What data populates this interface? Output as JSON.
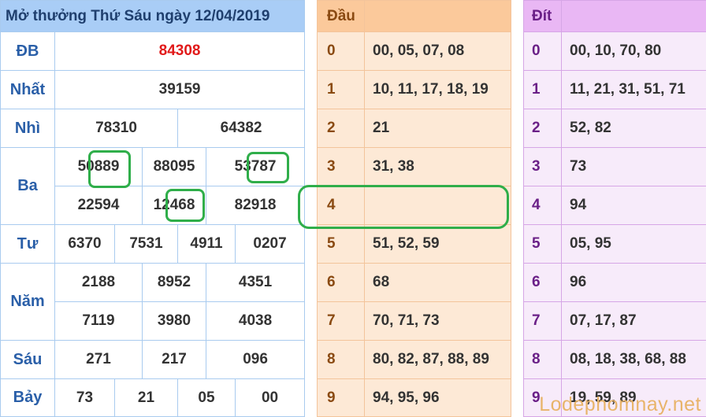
{
  "results": {
    "title": "Mở thưởng Thứ Sáu ngày 12/04/2019",
    "db_label": "ĐB",
    "db": "84308",
    "nhat_label": "Nhất",
    "nhat": "39159",
    "nhi_label": "Nhì",
    "nhi": [
      "78310",
      "64382"
    ],
    "ba_label": "Ba",
    "ba": [
      "50889",
      "88095",
      "53787",
      "22594",
      "12468",
      "82918"
    ],
    "tu_label": "Tư",
    "tu": [
      "6370",
      "7531",
      "4911",
      "0207"
    ],
    "nam_label": "Năm",
    "nam": [
      "2188",
      "8952",
      "4351",
      "7119",
      "3980",
      "4038"
    ],
    "sau_label": "Sáu",
    "sau": [
      "271",
      "217",
      "096"
    ],
    "bay_label": "Bảy",
    "bay": [
      "73",
      "21",
      "05",
      "00"
    ]
  },
  "dau": {
    "header": "Đầu",
    "rows": [
      {
        "num": "0",
        "val": "00, 05, 07, 08"
      },
      {
        "num": "1",
        "val": "10, 11, 17, 18, 19"
      },
      {
        "num": "2",
        "val": "21"
      },
      {
        "num": "3",
        "val": "31, 38"
      },
      {
        "num": "4",
        "val": ""
      },
      {
        "num": "5",
        "val": "51, 52, 59"
      },
      {
        "num": "6",
        "val": "68"
      },
      {
        "num": "7",
        "val": "70, 71, 73"
      },
      {
        "num": "8",
        "val": "80, 82, 87, 88, 89"
      },
      {
        "num": "9",
        "val": "94, 95, 96"
      }
    ]
  },
  "dit": {
    "header": "Đít",
    "rows": [
      {
        "num": "0",
        "val": "00, 10, 70, 80"
      },
      {
        "num": "1",
        "val": "11, 21, 31, 51, 71"
      },
      {
        "num": "2",
        "val": "52, 82"
      },
      {
        "num": "3",
        "val": "73"
      },
      {
        "num": "4",
        "val": "94"
      },
      {
        "num": "5",
        "val": "05, 95"
      },
      {
        "num": "6",
        "val": "96"
      },
      {
        "num": "7",
        "val": "07, 17, 87"
      },
      {
        "num": "8",
        "val": "08, 18, 38, 68, 88"
      },
      {
        "num": "9",
        "val": "19, 59, 89"
      }
    ]
  },
  "watermark": "Lodephomnay.net",
  "colors": {
    "accent_green": "#2fae4a",
    "db_red": "#e11a1a",
    "title_blue": "#a9cdf6",
    "dau_orange": "#fbc99b",
    "dit_purple": "#e9b7f4"
  }
}
